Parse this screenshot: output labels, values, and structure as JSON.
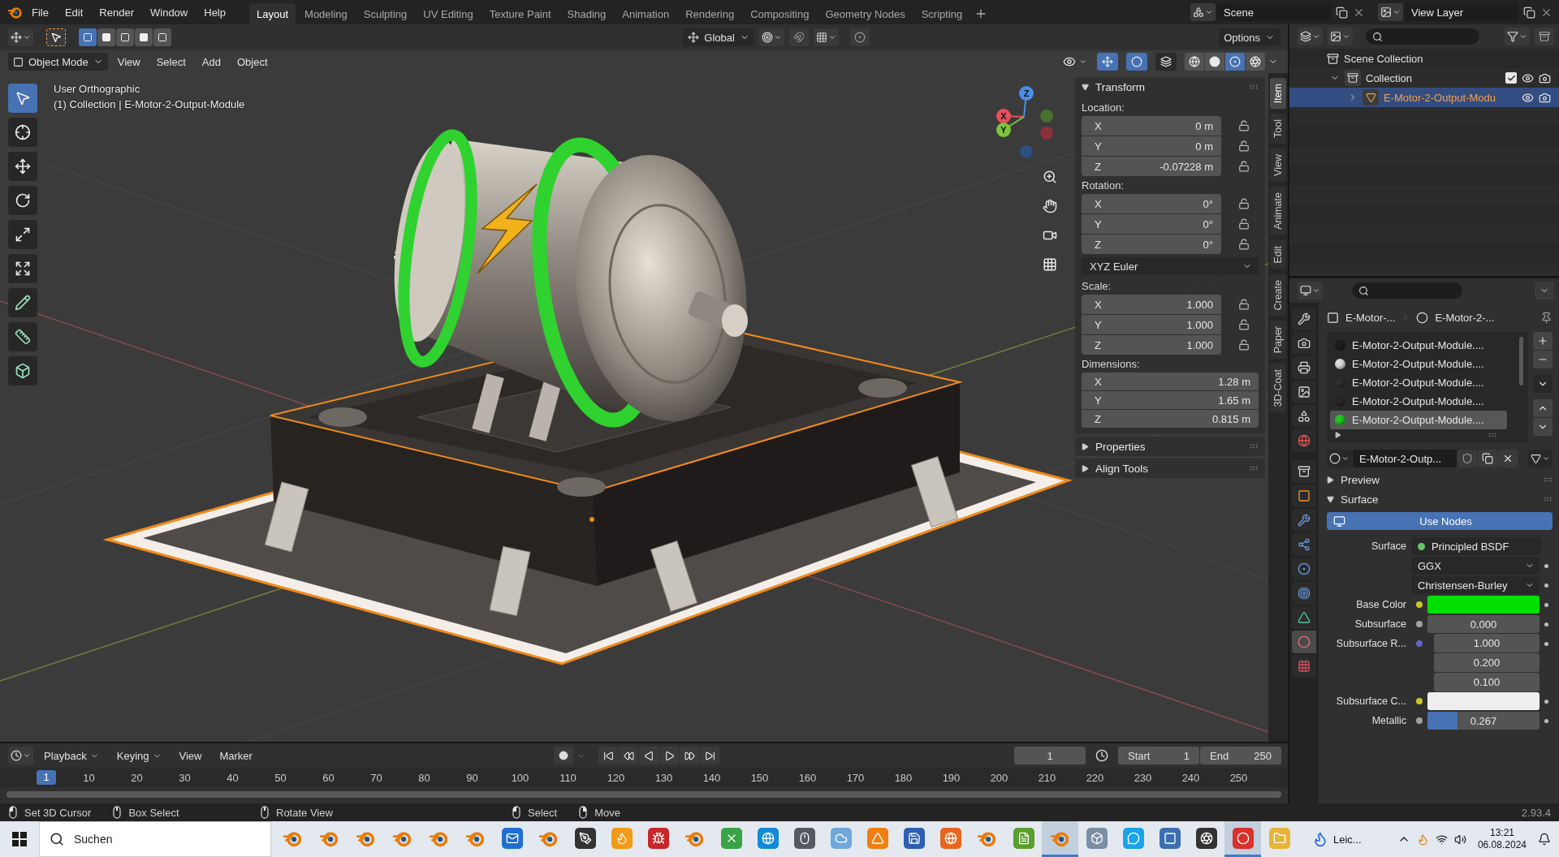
{
  "top_bar": {
    "menus": [
      "File",
      "Edit",
      "Render",
      "Window",
      "Help"
    ],
    "workspaces": [
      {
        "label": "Layout",
        "selected": true
      },
      {
        "label": "Modeling",
        "selected": false
      },
      {
        "label": "Sculpting",
        "selected": false
      },
      {
        "label": "UV Editing",
        "selected": false
      },
      {
        "label": "Texture Paint",
        "selected": false
      },
      {
        "label": "Shading",
        "selected": false
      },
      {
        "label": "Animation",
        "selected": false
      },
      {
        "label": "Rendering",
        "selected": false
      },
      {
        "label": "Compositing",
        "selected": false
      },
      {
        "label": "Geometry Nodes",
        "selected": false
      },
      {
        "label": "Scripting",
        "selected": false
      }
    ],
    "scene": "Scene",
    "view_layer": "View Layer"
  },
  "tool_header": {
    "select_modes": [
      {
        "selected": true
      },
      {
        "selected": false
      },
      {
        "selected": false
      },
      {
        "selected": false
      },
      {
        "selected": false
      }
    ],
    "orientation": "Global",
    "options": "Options"
  },
  "viewport": {
    "mode": "Object Mode",
    "menus": [
      "View",
      "Select",
      "Add",
      "Object"
    ],
    "toggles": [
      {
        "kind": "gizmo",
        "on": true
      },
      {
        "kind": "overlay",
        "on": true
      },
      {
        "kind": "xray",
        "on": false
      }
    ],
    "shading": [
      {
        "kind": "wireframe",
        "selected": false
      },
      {
        "kind": "solid",
        "selected": false
      },
      {
        "kind": "material",
        "selected": true
      },
      {
        "kind": "rendered",
        "selected": false
      }
    ],
    "view_name": "User Orthographic",
    "context": "(1) Collection | E-Motor-2-Output-Module",
    "tools": [
      {
        "kind": "select",
        "selected": true
      },
      {
        "kind": "cursor",
        "selected": false
      },
      {
        "kind": "move",
        "selected": false
      },
      {
        "kind": "rotate",
        "selected": false
      },
      {
        "kind": "scale",
        "selected": false
      },
      {
        "kind": "transform",
        "selected": false
      },
      {
        "kind": "annotate",
        "selected": false
      },
      {
        "kind": "measure",
        "selected": false
      },
      {
        "kind": "add_cube",
        "selected": false
      }
    ],
    "gizmo": {
      "x": "X",
      "y": "Y",
      "z": "Z"
    }
  },
  "sidebar": {
    "transform": {
      "title": "Transform",
      "expanded": true,
      "groups": [
        {
          "kind": "lockable",
          "label": "Location:",
          "fields": [
            {
              "axis": "X",
              "value": "0 m"
            },
            {
              "axis": "Y",
              "value": "0 m"
            },
            {
              "axis": "Z",
              "value": "-0.07228 m"
            }
          ]
        },
        {
          "kind": "lockable",
          "label": "Rotation:",
          "fields": [
            {
              "axis": "X",
              "value": "0°"
            },
            {
              "axis": "Y",
              "value": "0°"
            },
            {
              "axis": "Z",
              "value": "0°"
            }
          ]
        },
        {
          "kind": "dropdown",
          "value": "XYZ Euler"
        },
        {
          "kind": "lockable",
          "label": "Scale:",
          "fields": [
            {
              "axis": "X",
              "value": "1.000"
            },
            {
              "axis": "Y",
              "value": "1.000"
            },
            {
              "axis": "Z",
              "value": "1.000"
            }
          ]
        },
        {
          "kind": "plain",
          "label": "Dimensions:",
          "fields": [
            {
              "axis": "X",
              "value": "1.28 m"
            },
            {
              "axis": "Y",
              "value": "1.65 m"
            },
            {
              "axis": "Z",
              "value": "0.815 m"
            }
          ]
        }
      ]
    },
    "panels": [
      {
        "title": "Properties",
        "expanded": false
      },
      {
        "title": "Align Tools",
        "expanded": false
      }
    ],
    "tabs": [
      {
        "label": "Item",
        "selected": true
      },
      {
        "label": "Tool",
        "selected": false
      },
      {
        "label": "View",
        "selected": false
      },
      {
        "label": "Animate",
        "selected": false
      },
      {
        "label": "Edit",
        "selected": false
      },
      {
        "label": "Create",
        "selected": false
      },
      {
        "label": "Paper",
        "selected": false
      },
      {
        "label": "3D-Coat",
        "selected": false
      }
    ]
  },
  "outliner": {
    "tree": [
      {
        "kind": "scene_collection",
        "label": "Scene Collection",
        "selected": false,
        "children": [
          {
            "kind": "collection",
            "label": "Collection",
            "selected": false,
            "expanded": true,
            "checked": true,
            "children": [
              {
                "kind": "object",
                "label": "E-Motor-2-Output-Modu",
                "selected": true,
                "expanded": false
              }
            ]
          }
        ]
      }
    ]
  },
  "properties": {
    "tabs": [
      {
        "kind": "tool",
        "selected": false
      },
      {
        "kind": "render",
        "selected": false
      },
      {
        "kind": "output",
        "selected": false
      },
      {
        "kind": "view_layer",
        "selected": false
      },
      {
        "kind": "scene",
        "selected": false
      },
      {
        "kind": "world",
        "selected": false
      },
      {
        "kind": "collection",
        "selected": false
      },
      {
        "kind": "object",
        "selected": false
      },
      {
        "kind": "modifiers",
        "selected": false
      },
      {
        "kind": "particles",
        "selected": false
      },
      {
        "kind": "physics",
        "selected": false
      },
      {
        "kind": "constraints",
        "selected": false
      },
      {
        "kind": "data",
        "selected": false
      },
      {
        "kind": "material",
        "selected": true
      },
      {
        "kind": "texture",
        "selected": false
      }
    ],
    "breadcrumb": [
      "E-Motor-...",
      "E-Motor-2-..."
    ],
    "slots": [
      {
        "name": "E-Motor-2-Output-Module....",
        "color": "#1c1c1c",
        "selected": false
      },
      {
        "name": "E-Motor-2-Output-Module....",
        "color": "#d9d9d9",
        "selected": false
      },
      {
        "name": "E-Motor-2-Output-Module....",
        "color": "#2e2e2e",
        "selected": false
      },
      {
        "name": "E-Motor-2-Output-Module....",
        "color": "#262626",
        "selected": false
      },
      {
        "name": "E-Motor-2-Output-Module....",
        "color": "#22c422",
        "selected": true
      }
    ],
    "material": "E-Motor-2-Outp...",
    "panels": [
      {
        "title": "Preview",
        "expanded": false
      },
      {
        "title": "Surface",
        "expanded": true
      }
    ],
    "use_nodes": "Use Nodes",
    "rows": [
      {
        "kind": "link",
        "label": "Surface",
        "value": "Principled BSDF"
      },
      {
        "kind": "dropdown",
        "value": "GGX"
      },
      {
        "kind": "dropdown",
        "value": "Christensen-Burley"
      },
      {
        "kind": "color",
        "label": "Base Color",
        "color": "#00e000"
      },
      {
        "kind": "number",
        "label": "Subsurface",
        "value": "0.000"
      },
      {
        "kind": "vector",
        "label": "Subsurface R...",
        "values": [
          "1.000",
          "0.200",
          "0.100"
        ]
      },
      {
        "kind": "color",
        "label": "Subsurface C...",
        "color": "#eeeeee"
      },
      {
        "kind": "slider",
        "label": "Metallic",
        "value": "0.267",
        "level": 0.267
      }
    ]
  },
  "timeline": {
    "menus": [
      {
        "label": "Playback",
        "dropdown": true
      },
      {
        "label": "Keying",
        "dropdown": true
      },
      {
        "label": "View",
        "dropdown": false
      },
      {
        "label": "Marker",
        "dropdown": false
      }
    ],
    "current_frame": "1",
    "start_label": "Start",
    "start": "1",
    "end_label": "End",
    "end": "250",
    "ruler": {
      "current": "1",
      "ticks": [
        "10",
        "20",
        "30",
        "40",
        "50",
        "60",
        "70",
        "80",
        "90",
        "100",
        "110",
        "120",
        "130",
        "140",
        "150",
        "160",
        "170",
        "180",
        "190",
        "200",
        "210",
        "220",
        "230",
        "240",
        "250"
      ]
    }
  },
  "status_bar": {
    "groups": [
      {
        "hints": [
          {
            "kind": "left",
            "label": "Set 3D Cursor"
          },
          {
            "kind": "middle",
            "label": "Box Select"
          }
        ]
      },
      {
        "hints": [
          {
            "kind": "middle",
            "label": "Rotate View"
          }
        ]
      },
      {
        "hints": [
          {
            "kind": "left",
            "label": "Select"
          },
          {
            "kind": "right",
            "label": "Move"
          }
        ]
      }
    ],
    "version": "2.93.4"
  },
  "taskbar": {
    "search_placeholder": "Suchen",
    "apps": [
      {
        "kind": "blender",
        "active": false
      },
      {
        "kind": "blender",
        "active": false
      },
      {
        "kind": "blender",
        "active": false
      },
      {
        "kind": "blender",
        "active": false
      },
      {
        "kind": "blender",
        "active": false
      },
      {
        "kind": "blender",
        "active": false
      },
      {
        "kind": "mail",
        "active": false
      },
      {
        "kind": "blender",
        "active": false
      },
      {
        "kind": "pen",
        "active": false
      },
      {
        "kind": "flame",
        "active": false
      },
      {
        "kind": "bug",
        "active": false
      },
      {
        "kind": "blender",
        "active": false
      },
      {
        "kind": "cross",
        "active": false
      },
      {
        "kind": "globe",
        "active": false
      },
      {
        "kind": "mouse",
        "active": false
      },
      {
        "kind": "cloud",
        "active": false
      },
      {
        "kind": "cone",
        "active": false
      },
      {
        "kind": "floppy",
        "active": false
      },
      {
        "kind": "fox",
        "active": false
      },
      {
        "kind": "blender",
        "active": false
      },
      {
        "kind": "notes",
        "active": false
      },
      {
        "kind": "blender",
        "active": true
      },
      {
        "kind": "cube",
        "active": false
      },
      {
        "kind": "chat",
        "active": false
      },
      {
        "kind": "square",
        "active": false
      },
      {
        "kind": "aperture",
        "active": false
      },
      {
        "kind": "ring",
        "active": true
      },
      {
        "kind": "folder",
        "active": false
      }
    ],
    "labeled_app": "Leic...",
    "time": "13:21",
    "date": "06.08.2024"
  }
}
